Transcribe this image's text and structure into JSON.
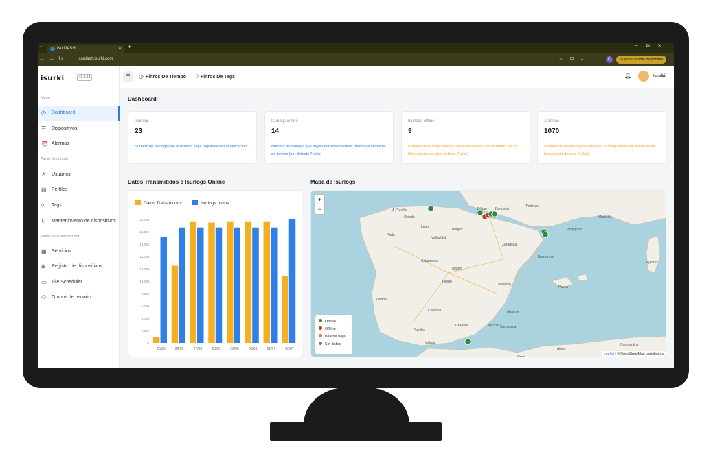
{
  "browser": {
    "tab_title": "IsurDASH",
    "url": "isurdash.isurki.com",
    "update_label": "Nuevo Chrome disponible",
    "profile_initial": "C"
  },
  "sidebar": {
    "logo": "isurki",
    "version": "v1.3.14",
    "sections": {
      "menu": "Menu",
      "control": "Panel de control",
      "admin": "Panel de administrador"
    },
    "items": [
      {
        "label": "Dashboard",
        "icon": "dashboard-icon"
      },
      {
        "label": "Dispositivos",
        "icon": "list-icon"
      },
      {
        "label": "Alarmas",
        "icon": "alarm-icon"
      },
      {
        "label": "Usuarios",
        "icon": "user-icon"
      },
      {
        "label": "Perfiles",
        "icon": "profile-icon"
      },
      {
        "label": "Tags",
        "icon": "tag-icon"
      },
      {
        "label": "Mantenimiento de dispositivos",
        "icon": "maintenance-icon"
      },
      {
        "label": "Servicios",
        "icon": "services-icon"
      },
      {
        "label": "Registro de dispositivos",
        "icon": "register-icon"
      },
      {
        "label": "File Scheduler",
        "icon": "calendar-icon"
      },
      {
        "label": "Grupos de usuario",
        "icon": "group-icon"
      }
    ]
  },
  "topbar": {
    "time_filter": "Filtros De Tiempo",
    "tag_filter": "Filtros De Tags",
    "user": "Isurki"
  },
  "main": {
    "title": "Dashboard",
    "cards": [
      {
        "label": "Isurlogs",
        "value": "23",
        "desc": "Número de Isurlogs que el usuario haya registrado en la aplicación",
        "color": "#2a7be4"
      },
      {
        "label": "Isurlogs online",
        "value": "14",
        "desc": "Número de Isurlogs que hayan transmitido datos dentro de los filtros de tiempo (por defecto 7 días)",
        "color": "#2a7be4"
      },
      {
        "label": "Isurlogs offline",
        "value": "9",
        "desc": "Número de Isurlogs que no hayan transmitido datos dentro de los filtros de tiempo (por defecto 7 días)",
        "color": "#f5a623"
      },
      {
        "label": "Alarmas",
        "value": "1070",
        "desc": "Número de alarmas generadas por Isurlogs dentro de los filtros de tiempo (por defecto 7 días)",
        "color": "#f5a623"
      }
    ],
    "chart_title": "Datos Transmitidos e Isurlogs Online",
    "map_title": "Mapa de Isurlogs"
  },
  "chart_data": {
    "type": "bar",
    "categories": [
      "25/06",
      "26/06",
      "27/06",
      "28/06",
      "29/06",
      "30/06",
      "01/07",
      "02/07"
    ],
    "series": [
      {
        "name": "Datos Transmitidos",
        "color": "#f5b021",
        "values": [
          1000,
          12500,
          19700,
          19500,
          19700,
          19700,
          19700,
          10800
        ]
      },
      {
        "name": "Isurlogs online",
        "color": "#2f7fe8",
        "values": [
          17200,
          18700,
          18700,
          18700,
          18700,
          18700,
          18700,
          20000
        ]
      }
    ],
    "yticks": [
      "0",
      "2,000",
      "4,000",
      "6,000",
      "8,000",
      "10,000",
      "12,000",
      "14,000",
      "16,000",
      "18,000",
      "20,000"
    ],
    "ylim": [
      0,
      20000
    ],
    "legend": "top-left"
  },
  "map": {
    "zoom_in": "+",
    "zoom_out": "−",
    "legend": [
      {
        "label": "Online",
        "color": "#2e8b3a"
      },
      {
        "label": "Offline",
        "color": "#c9302c"
      },
      {
        "label": "Batería baja",
        "color": "#e67e22"
      },
      {
        "label": "Sin datos",
        "color": "#777777"
      }
    ],
    "attribution_leaflet": "Leaflet",
    "attribution_rest": " | © OpenStreetMap contributors",
    "cities": [
      "A Coruña",
      "Bilbao",
      "Donostia",
      "Toulouse",
      "Marseille",
      "Zaragoza",
      "Barcelona",
      "Madrid",
      "Valencia",
      "Lisboa",
      "Sevilla",
      "Málaga",
      "Granada",
      "Murcia",
      "Palma",
      "Porto",
      "Valladolid",
      "Burgos",
      "León",
      "Oviedo",
      "Salamanca",
      "Toledo",
      "Córdoba",
      "Alicante",
      "Cartagena",
      "Oran",
      "Alger",
      "Constantine",
      "Ajaccio",
      "Perpignan"
    ]
  }
}
